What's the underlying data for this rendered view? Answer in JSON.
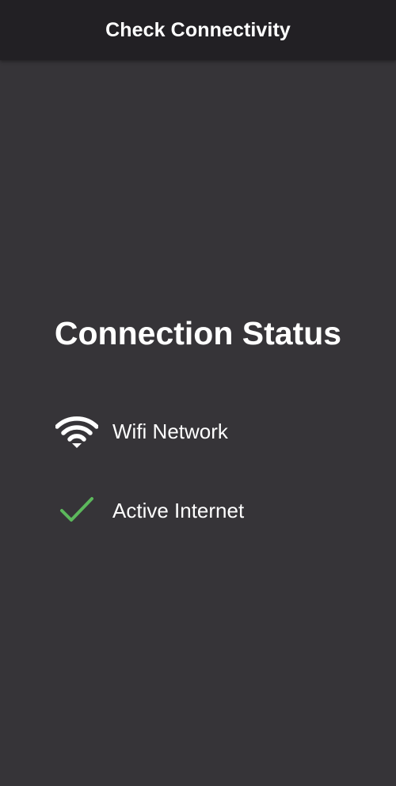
{
  "app_bar": {
    "title": "Check Connectivity"
  },
  "status": {
    "heading": "Connection Status",
    "items": [
      {
        "label": "Wifi Network",
        "icon": "wifi-icon",
        "color": "#ffffff"
      },
      {
        "label": "Active Internet",
        "icon": "check-icon",
        "color": "#5cb85c"
      }
    ]
  },
  "colors": {
    "background": "#363438",
    "app_bar": "#222024",
    "check": "#5cb85c"
  }
}
